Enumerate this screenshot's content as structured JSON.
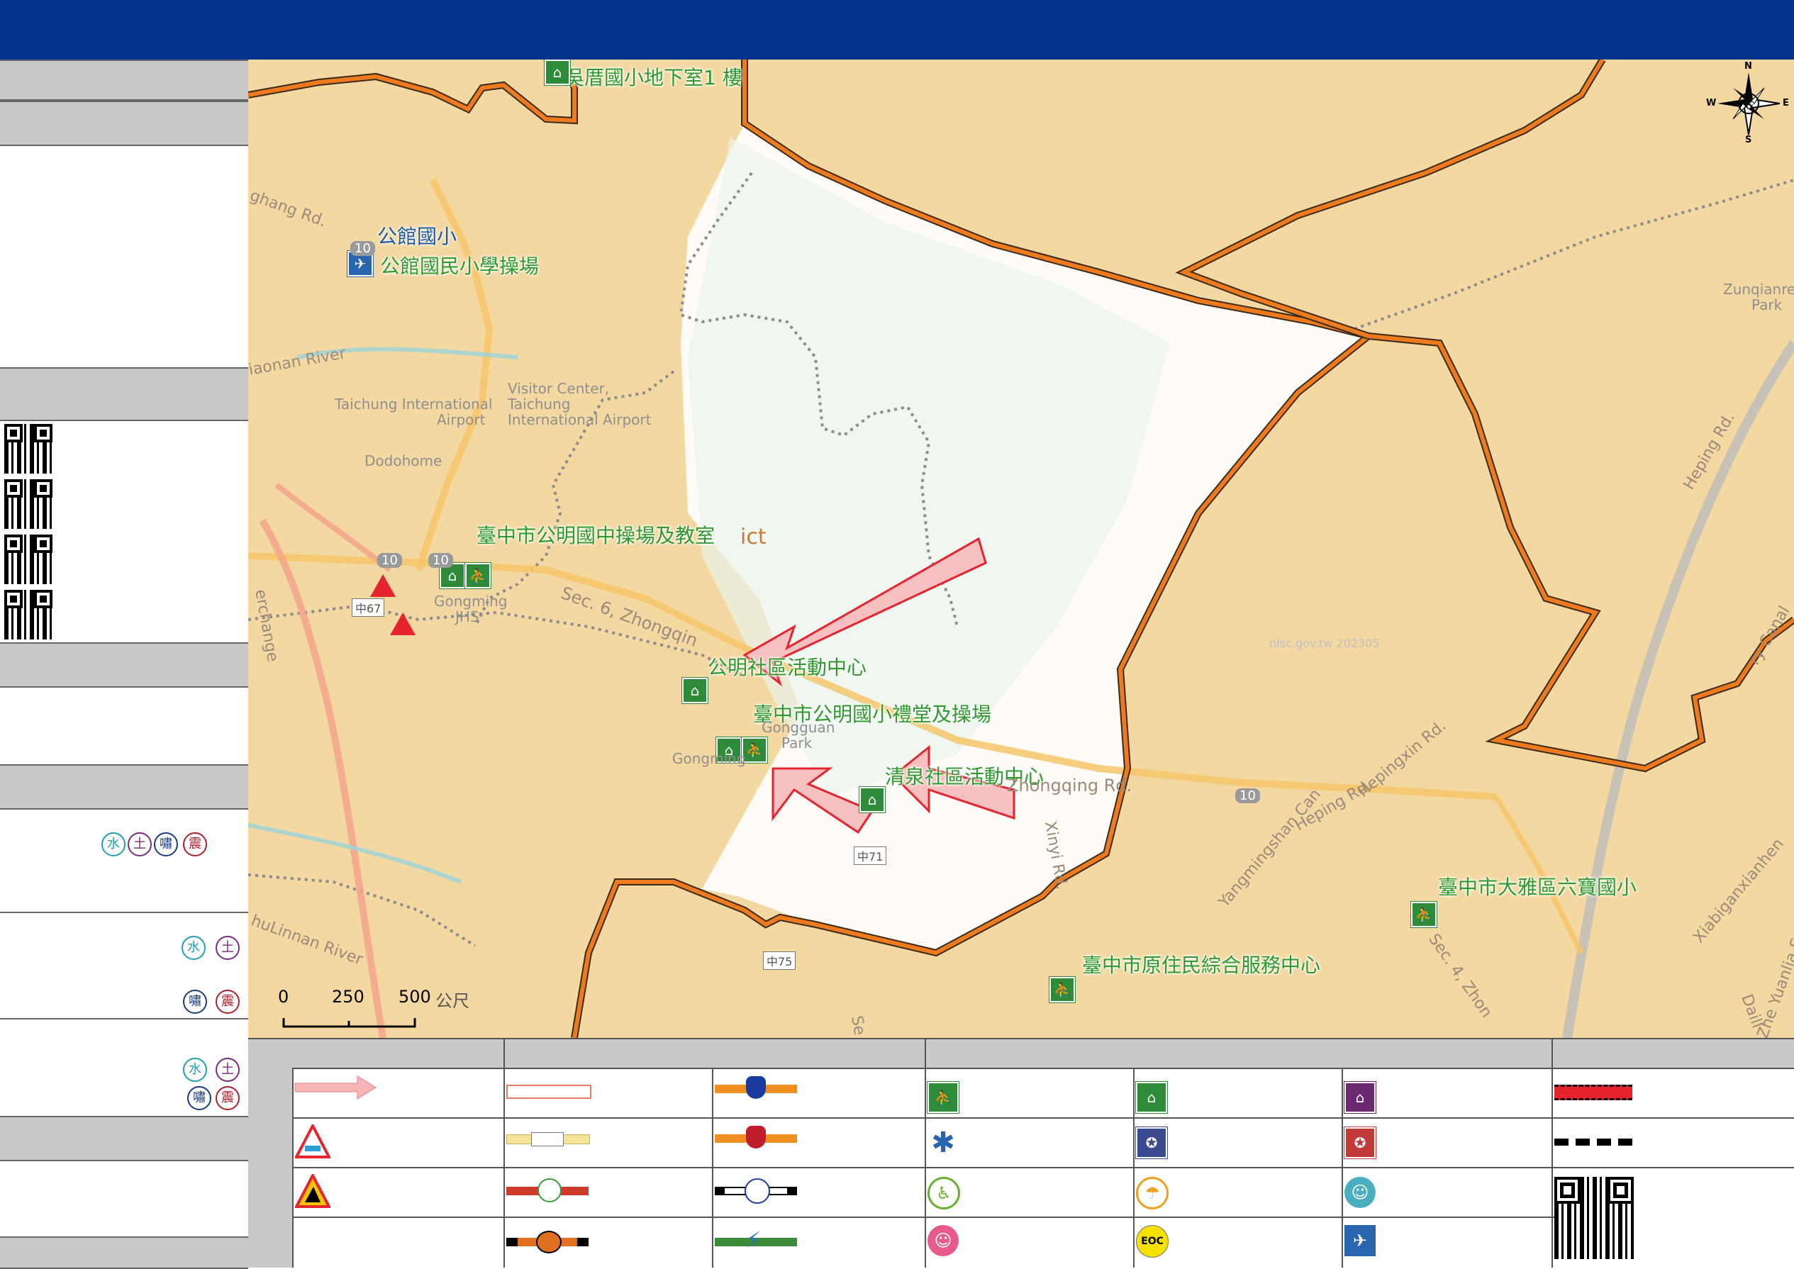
{
  "map": {
    "shelters": [
      {
        "name": "吳厝國小地下室1 樓"
      },
      {
        "name": "公館國民小學操場"
      },
      {
        "name": "臺中市公明國中操場及教室"
      },
      {
        "name": "公明社區活動中心"
      },
      {
        "name": "臺中市公明國小禮堂及操場"
      },
      {
        "name": "清泉社區活動中心"
      },
      {
        "name": "臺中市大雅區六寶國小"
      },
      {
        "name": "臺中市原住民綜合服務中心"
      }
    ],
    "helipad_label": "公館國小",
    "basemap_labels": [
      "ghang Rd.",
      "iaonan River",
      "Taichung International",
      "Airport",
      "Visitor Center,",
      "Taichung",
      "International Airport",
      "Dodohome",
      "Gongming",
      "JHS",
      "Sec. 6, Zhongqin",
      "Gongguan",
      "Park",
      "Gongming",
      "Zhongqing Rd.",
      "Xinyi Rd.",
      "Yangmingshan Can",
      "Heping Rd.",
      "Hepingxin Rd.",
      "Heping Rd.",
      "Zunqianre",
      "Park",
      "ry Canal",
      "Xiabiganxianhen",
      "Sec. 4, Zhon",
      "huLinnan River",
      "ict",
      "erchange",
      "Se",
      "Daili",
      "nlsc.gov.tw 202305",
      "Zhe Yuanlia Seconda"
    ],
    "road_shields": [
      "10",
      "10",
      "10",
      "10",
      "中67",
      "中71",
      "中75"
    ],
    "scale_bar": {
      "ticks": [
        "0",
        "250",
        "500"
      ],
      "unit": "公尺"
    },
    "compass": {
      "n": "N",
      "s": "S",
      "e": "E",
      "w": "W"
    }
  },
  "sidebar": {
    "hazard_badges": [
      "水",
      "土",
      "嘯",
      "震"
    ]
  },
  "legend": {
    "eoc_label": "EOC"
  },
  "colors": {
    "header": "#03348c",
    "boundary": "#e8711e",
    "shelter_green": "#2e9a2e",
    "evac_arrow": "#e5242e",
    "map_bg": "#f4d8a2"
  }
}
